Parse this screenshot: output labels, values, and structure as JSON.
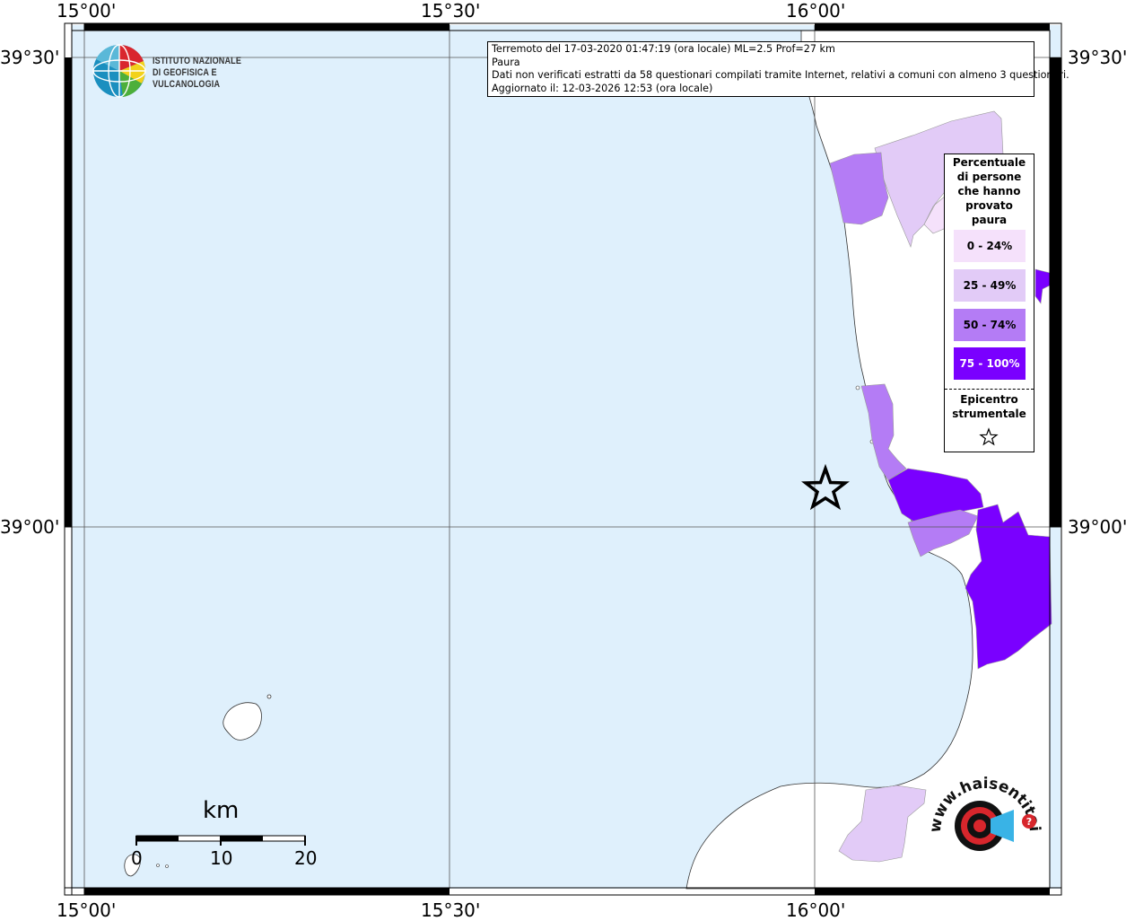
{
  "map": {
    "top_lon_labels": [
      "15°00'",
      "15°30'",
      "16°00'"
    ],
    "bottom_lon_labels": [
      "15°00'",
      "15°30'",
      "16°00'"
    ],
    "left_lat_labels": [
      "39°30'",
      "39°00'"
    ],
    "right_lat_labels": [
      "39°30'",
      "39°00'"
    ],
    "sea_color": "#dff0fc",
    "land_color": "#ffffff"
  },
  "info": {
    "line1": "Terremoto del 17-03-2020 01:47:19 (ora locale) ML=2.5 Prof=27 km",
    "line2": "Paura",
    "line3": "Dati non verificati estratti da 58 questionari compilati tramite Internet, relativi a comuni con almeno 3 questionari.",
    "line4": "Aggiornato il: 12-03-2026 12:53 (ora locale)"
  },
  "logo": {
    "line1": "ISTITUTO NAZIONALE",
    "line2": "DI GEOFISICA E VULCANOLOGIA"
  },
  "legend": {
    "title_lines": [
      "Percentuale",
      "di persone",
      "che hanno",
      "provato",
      "paura"
    ],
    "classes": [
      {
        "label": "0 - 24%",
        "color": "#f5e1fb",
        "text_color": "#000000"
      },
      {
        "label": "25 - 49%",
        "color": "#e2cbf7",
        "text_color": "#000000"
      },
      {
        "label": "50 - 74%",
        "color": "#b47cf5",
        "text_color": "#000000"
      },
      {
        "label": "75 - 100%",
        "color": "#7a00ff",
        "text_color": "#ffffff"
      }
    ],
    "epicenter_lines": [
      "Epicentro",
      "strumentale"
    ]
  },
  "scale": {
    "unit": "km",
    "ticks": [
      "0",
      "10",
      "20"
    ]
  },
  "watermark": {
    "text": "www.haisentitoilterremoto.it"
  }
}
